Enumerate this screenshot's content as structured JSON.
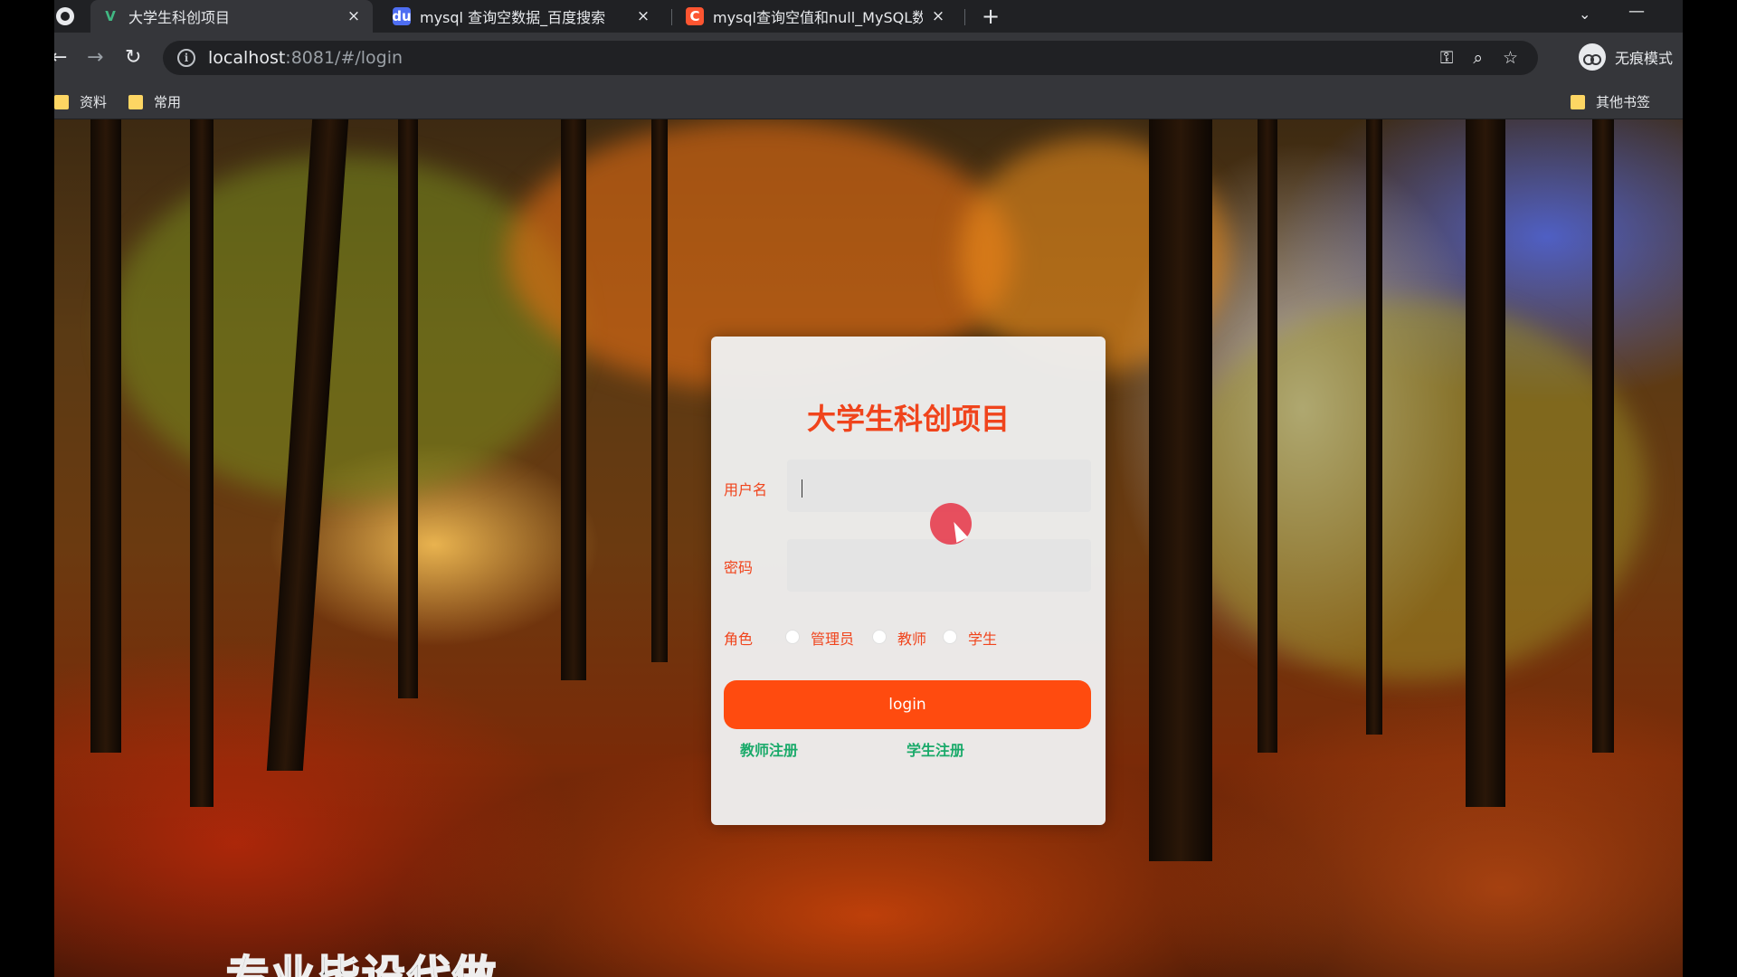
{
  "browser": {
    "tabs": [
      {
        "title": "大学生科创项目",
        "favicon": "vue-icon",
        "active": true
      },
      {
        "title": "mysql 查询空数据_百度搜索",
        "favicon": "baidu-icon",
        "active": false
      },
      {
        "title": "mysql查询空值和null_MySQL数",
        "favicon": "csdn-icon",
        "active": false
      }
    ],
    "new_tab_glyph": "+",
    "close_glyph": "×",
    "url_host": "localhost",
    "url_path": ":8081/#/login",
    "profile_label": "无痕模式",
    "bookmarks": [
      {
        "label": "资料"
      },
      {
        "label": "常用"
      }
    ],
    "other_bookmarks": "其他书签",
    "accent_color": "#35363a"
  },
  "login": {
    "title": "大学生科创项目",
    "username_label": "用户名",
    "username_value": "",
    "password_label": "密码",
    "password_value": "",
    "role_label": "角色",
    "roles": [
      {
        "label": "管理员",
        "checked": false
      },
      {
        "label": "教师",
        "checked": false
      },
      {
        "label": "学生",
        "checked": false
      }
    ],
    "login_button": "login",
    "teacher_register": "教师注册",
    "student_register": "学生注册",
    "title_color": "#f0441c",
    "button_color": "#ff4b0f",
    "link_color": "#1aaa6a"
  },
  "overlay": {
    "subtitle": "专业毕设代做"
  }
}
